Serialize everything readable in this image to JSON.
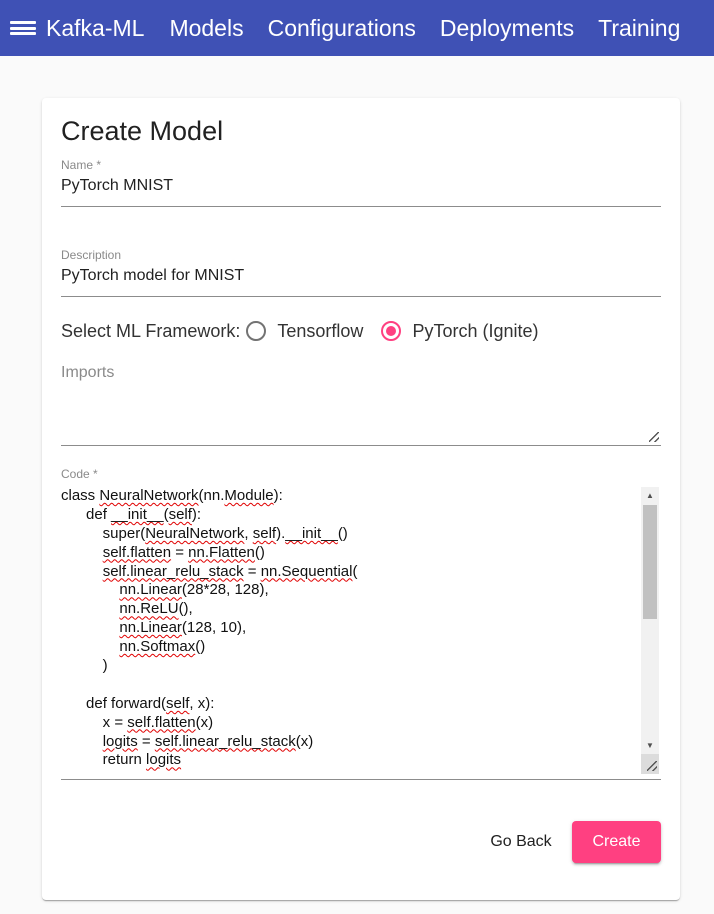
{
  "toolbar": {
    "brand": "Kafka-ML",
    "nav": [
      "Models",
      "Configurations",
      "Deployments",
      "Training"
    ]
  },
  "card": {
    "title": "Create Model",
    "name_label": "Name *",
    "name_value": "PyTorch MNIST",
    "description_label": "Description",
    "description_value": "PyTorch model for MNIST",
    "framework_label": "Select ML Framework:",
    "framework_options": [
      "Tensorflow",
      "PyTorch (Ignite)"
    ],
    "framework_selected": "PyTorch (Ignite)",
    "imports_placeholder": "Imports",
    "code_label": "Code *",
    "code_lines": [
      [
        {
          "t": "class "
        },
        {
          "t": "NeuralNetwork",
          "sq": true
        },
        {
          "t": "(nn."
        },
        {
          "t": "Module",
          "sq": true
        },
        {
          "t": "):"
        }
      ],
      [
        {
          "t": "      def "
        },
        {
          "t": "__init__",
          "sq": true
        },
        {
          "t": "("
        },
        {
          "t": "self",
          "sq": true
        },
        {
          "t": "):"
        }
      ],
      [
        {
          "t": "          super("
        },
        {
          "t": "NeuralNetwork",
          "sq": true
        },
        {
          "t": ", "
        },
        {
          "t": "self",
          "sq": true
        },
        {
          "t": ")."
        },
        {
          "t": "__init__",
          "sq": true
        },
        {
          "t": "()"
        }
      ],
      [
        {
          "t": "          "
        },
        {
          "t": "self.flatten",
          "sq": true
        },
        {
          "t": " = "
        },
        {
          "t": "nn.Flatten",
          "sq": true
        },
        {
          "t": "()"
        }
      ],
      [
        {
          "t": "          "
        },
        {
          "t": "self.linear_relu_stack",
          "sq": true
        },
        {
          "t": " = "
        },
        {
          "t": "nn.Sequential",
          "sq": true
        },
        {
          "t": "("
        }
      ],
      [
        {
          "t": "              "
        },
        {
          "t": "nn.Linear",
          "sq": true
        },
        {
          "t": "(28*28, 128),"
        }
      ],
      [
        {
          "t": "              "
        },
        {
          "t": "nn.ReLU",
          "sq": true
        },
        {
          "t": "(),"
        }
      ],
      [
        {
          "t": "              "
        },
        {
          "t": "nn.Linear",
          "sq": true
        },
        {
          "t": "(128, 10),"
        }
      ],
      [
        {
          "t": "              "
        },
        {
          "t": "nn.Softmax",
          "sq": true
        },
        {
          "t": "()"
        }
      ],
      [
        {
          "t": "          )"
        }
      ],
      [
        {
          "t": ""
        }
      ],
      [
        {
          "t": "      def forward("
        },
        {
          "t": "self",
          "sq": true
        },
        {
          "t": ", x):"
        }
      ],
      [
        {
          "t": "          x = "
        },
        {
          "t": "self.flatten",
          "sq": true
        },
        {
          "t": "(x)"
        }
      ],
      [
        {
          "t": "          "
        },
        {
          "t": "logits",
          "sq": true
        },
        {
          "t": " = "
        },
        {
          "t": "self.linear_relu_stack",
          "sq": true
        },
        {
          "t": "(x)"
        }
      ],
      [
        {
          "t": "          return "
        },
        {
          "t": "logits",
          "sq": true
        }
      ]
    ],
    "back_label": "Go Back",
    "create_label": "Create"
  },
  "colors": {
    "primary": "#3f51b5",
    "accent": "#ff4081"
  }
}
